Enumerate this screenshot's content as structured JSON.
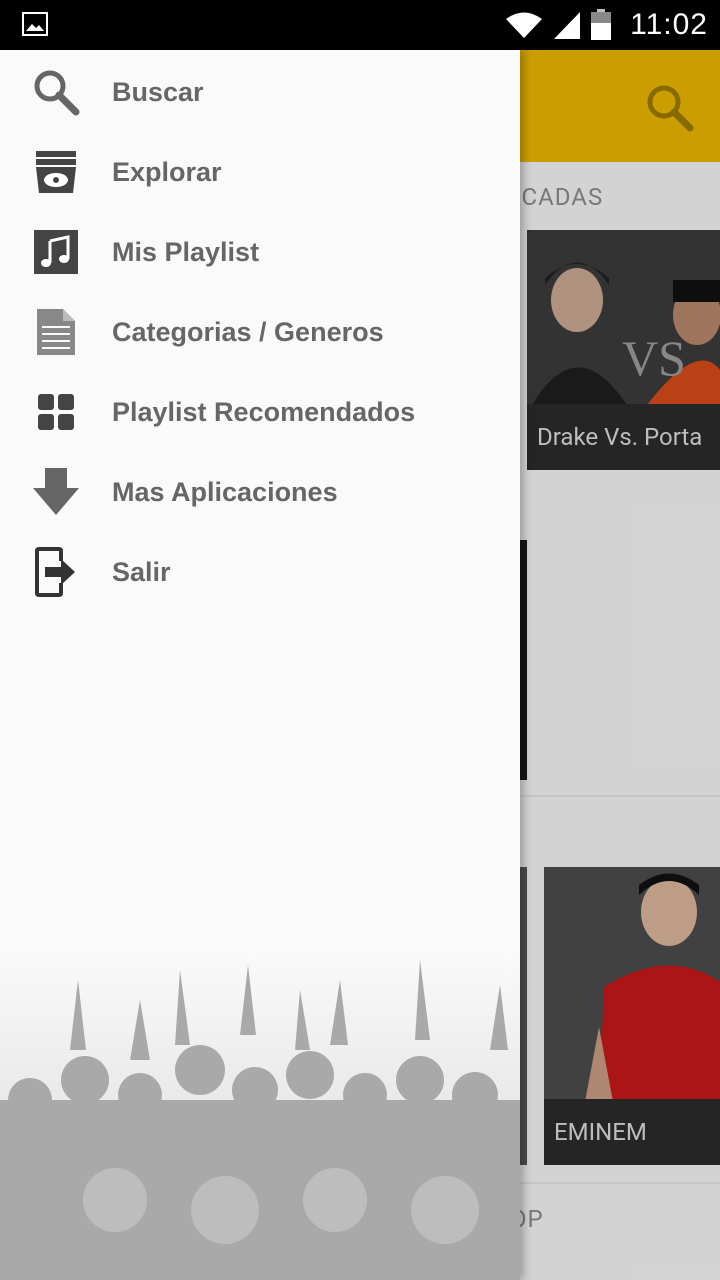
{
  "status_bar": {
    "time": "11:02"
  },
  "app": {
    "section_featured_partial": "ACADAS",
    "section_bottom_partial": "OP",
    "cards": [
      {
        "caption": "Drake Vs. Porta",
        "vs_text": "VS"
      },
      {
        "caption": "EMINEM"
      }
    ]
  },
  "drawer": {
    "items": [
      {
        "label": "Buscar",
        "icon": "search-icon"
      },
      {
        "label": "Explorar",
        "icon": "explore-icon"
      },
      {
        "label": "Mis Playlist",
        "icon": "music-note-icon"
      },
      {
        "label": "Categorias / Generos",
        "icon": "document-icon"
      },
      {
        "label": "Playlist Recomendados",
        "icon": "grid-icon"
      },
      {
        "label": "Mas Aplicaciones",
        "icon": "download-arrow-icon"
      },
      {
        "label": "Salir",
        "icon": "exit-icon"
      }
    ]
  },
  "colors": {
    "toolbar": "#e8b400",
    "menu_text": "#666666",
    "drawer_bg": "#fafafa"
  }
}
